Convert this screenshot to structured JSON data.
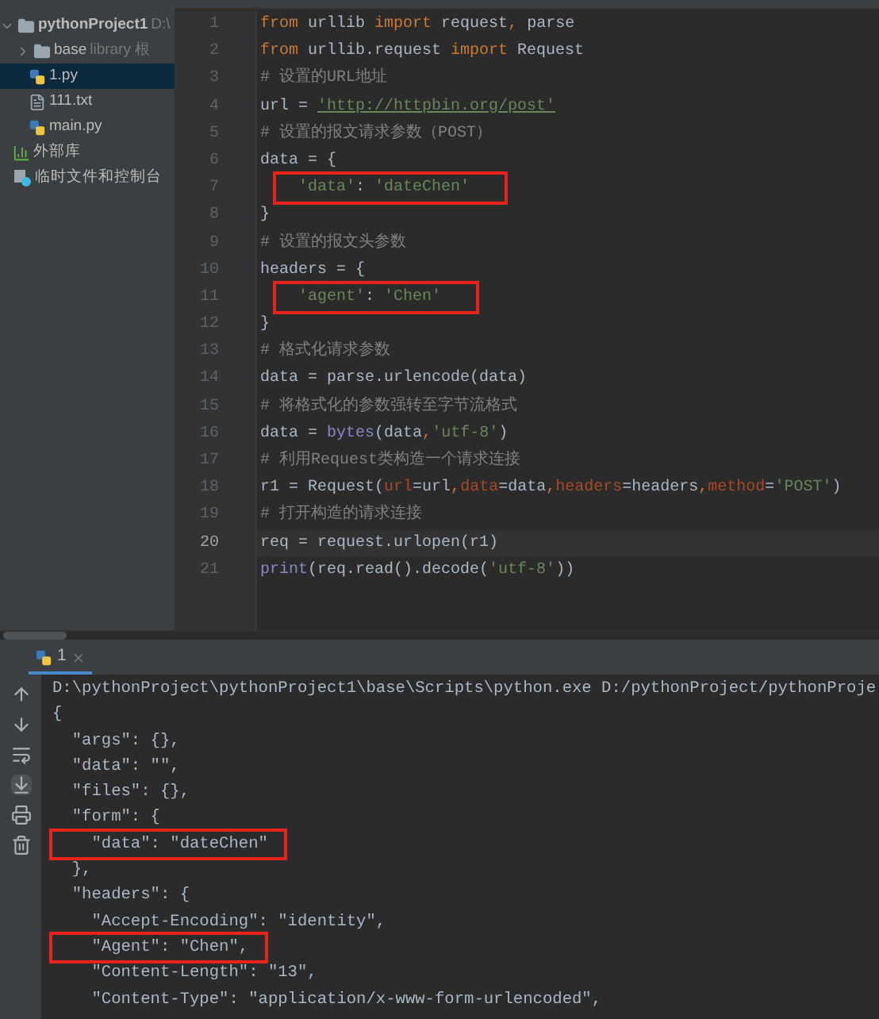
{
  "project_tree": [
    {
      "label": "pythonProject1",
      "note": "D:\\",
      "kind": "project",
      "expanded": true,
      "selected": false,
      "children": [
        {
          "label": "base",
          "note": "library 根",
          "kind": "folder",
          "expanded": false,
          "selected": false
        },
        {
          "label": "1.py",
          "kind": "python",
          "selected": true
        },
        {
          "label": "111.txt",
          "kind": "text",
          "selected": false
        },
        {
          "label": "main.py",
          "kind": "python",
          "selected": false
        }
      ]
    },
    {
      "label": "外部库",
      "kind": "library",
      "selected": false
    },
    {
      "label": "临时文件和控制台",
      "kind": "scratch",
      "selected": false
    }
  ],
  "editor": {
    "lines": [
      {
        "number": "1",
        "tokens": [
          {
            "kind": "keyword",
            "text": "from"
          },
          {
            "kind": "plain",
            "text": " urllib "
          },
          {
            "kind": "keyword",
            "text": "import"
          },
          {
            "kind": "plain",
            "text": " request"
          },
          {
            "kind": "keyword",
            "text": ","
          },
          {
            "kind": "plain",
            "text": " parse"
          }
        ]
      },
      {
        "number": "2",
        "tokens": [
          {
            "kind": "keyword",
            "text": "from"
          },
          {
            "kind": "plain",
            "text": " urllib.request "
          },
          {
            "kind": "keyword",
            "text": "import"
          },
          {
            "kind": "plain",
            "text": " Request"
          }
        ]
      },
      {
        "number": "3",
        "tokens": [
          {
            "kind": "comment",
            "text": "# 设置的URL地址"
          }
        ]
      },
      {
        "number": "4",
        "tokens": [
          {
            "kind": "plain",
            "text": "url = "
          },
          {
            "kind": "url",
            "text": "'http://httpbin.org/post'"
          }
        ]
      },
      {
        "number": "5",
        "tokens": [
          {
            "kind": "comment",
            "text": "# 设置的报文请求参数（POST）"
          }
        ]
      },
      {
        "number": "6",
        "tokens": [
          {
            "kind": "plain",
            "text": "data = {"
          }
        ]
      },
      {
        "number": "7",
        "boxed": true,
        "indented": true,
        "tokens": [
          {
            "kind": "string",
            "text": "'data'"
          },
          {
            "kind": "plain",
            "text": ": "
          },
          {
            "kind": "string",
            "text": "'dateChen'"
          }
        ]
      },
      {
        "number": "8",
        "tokens": [
          {
            "kind": "plain",
            "text": "}"
          }
        ]
      },
      {
        "number": "9",
        "tokens": [
          {
            "kind": "comment",
            "text": "# 设置的报文头参数"
          }
        ]
      },
      {
        "number": "10",
        "tokens": [
          {
            "kind": "plain",
            "text": "headers = {"
          }
        ]
      },
      {
        "number": "11",
        "boxed": true,
        "indented": true,
        "tokens": [
          {
            "kind": "string",
            "text": "'agent'"
          },
          {
            "kind": "plain",
            "text": ": "
          },
          {
            "kind": "string",
            "text": "'Chen'"
          }
        ]
      },
      {
        "number": "12",
        "tokens": [
          {
            "kind": "plain",
            "text": "}"
          }
        ]
      },
      {
        "number": "13",
        "tokens": [
          {
            "kind": "comment",
            "text": "# 格式化请求参数"
          }
        ]
      },
      {
        "number": "14",
        "tokens": [
          {
            "kind": "plain",
            "text": "data = parse.urlencode(data)"
          }
        ]
      },
      {
        "number": "15",
        "tokens": [
          {
            "kind": "comment",
            "text": "# 将格式化的参数强转至字节流格式"
          }
        ]
      },
      {
        "number": "16",
        "tokens": [
          {
            "kind": "plain",
            "text": "data = "
          },
          {
            "kind": "builtin",
            "text": "bytes"
          },
          {
            "kind": "plain",
            "text": "(data"
          },
          {
            "kind": "keyword",
            "text": ","
          },
          {
            "kind": "string",
            "text": "'utf-8'"
          },
          {
            "kind": "plain",
            "text": ")"
          }
        ]
      },
      {
        "number": "17",
        "tokens": [
          {
            "kind": "comment",
            "text": "# 利用Request类构造一个请求连接"
          }
        ]
      },
      {
        "number": "18",
        "tokens": [
          {
            "kind": "plain",
            "text": "r1 = Request("
          },
          {
            "kind": "param",
            "text": "url"
          },
          {
            "kind": "plain",
            "text": "=url"
          },
          {
            "kind": "keyword",
            "text": ","
          },
          {
            "kind": "param",
            "text": "data"
          },
          {
            "kind": "plain",
            "text": "=data"
          },
          {
            "kind": "keyword",
            "text": ","
          },
          {
            "kind": "param",
            "text": "headers"
          },
          {
            "kind": "plain",
            "text": "=headers"
          },
          {
            "kind": "keyword",
            "text": ","
          },
          {
            "kind": "param",
            "text": "method"
          },
          {
            "kind": "plain",
            "text": "="
          },
          {
            "kind": "string",
            "text": "'POST'"
          },
          {
            "kind": "plain",
            "text": ")"
          }
        ]
      },
      {
        "number": "19",
        "tokens": [
          {
            "kind": "comment",
            "text": "# 打开构造的请求连接"
          }
        ]
      },
      {
        "number": "20",
        "current": true,
        "tokens": [
          {
            "kind": "plain",
            "text": "req = request.urlopen(r1)"
          }
        ]
      },
      {
        "number": "21",
        "tokens": [
          {
            "kind": "builtin",
            "text": "print"
          },
          {
            "kind": "plain",
            "text": "(req.read().decode("
          },
          {
            "kind": "string",
            "text": "'utf-8'"
          },
          {
            "kind": "plain",
            "text": "))"
          }
        ]
      }
    ]
  },
  "run_panel": {
    "tabs": [
      {
        "label": "1",
        "selected": true
      }
    ],
    "output": [
      {
        "text": "D:\\pythonProject\\pythonProject1\\base\\Scripts\\python.exe D:/pythonProject/pythonProje"
      },
      {
        "text": "{"
      },
      {
        "text": "  \"args\": {},"
      },
      {
        "text": "  \"data\": \"\","
      },
      {
        "text": "  \"files\": {},"
      },
      {
        "text": "  \"form\": {"
      },
      {
        "text": "    \"data\": \"dateChen\"",
        "boxed": true
      },
      {
        "text": "  },"
      },
      {
        "text": "  \"headers\": {"
      },
      {
        "text": "    \"Accept-Encoding\": \"identity\","
      },
      {
        "text": "    \"Agent\": \"Chen\",",
        "boxed": true
      },
      {
        "text": "    \"Content-Length\": \"13\","
      },
      {
        "text": "    \"Content-Type\": \"application/x-www-form-urlencoded\","
      }
    ]
  }
}
